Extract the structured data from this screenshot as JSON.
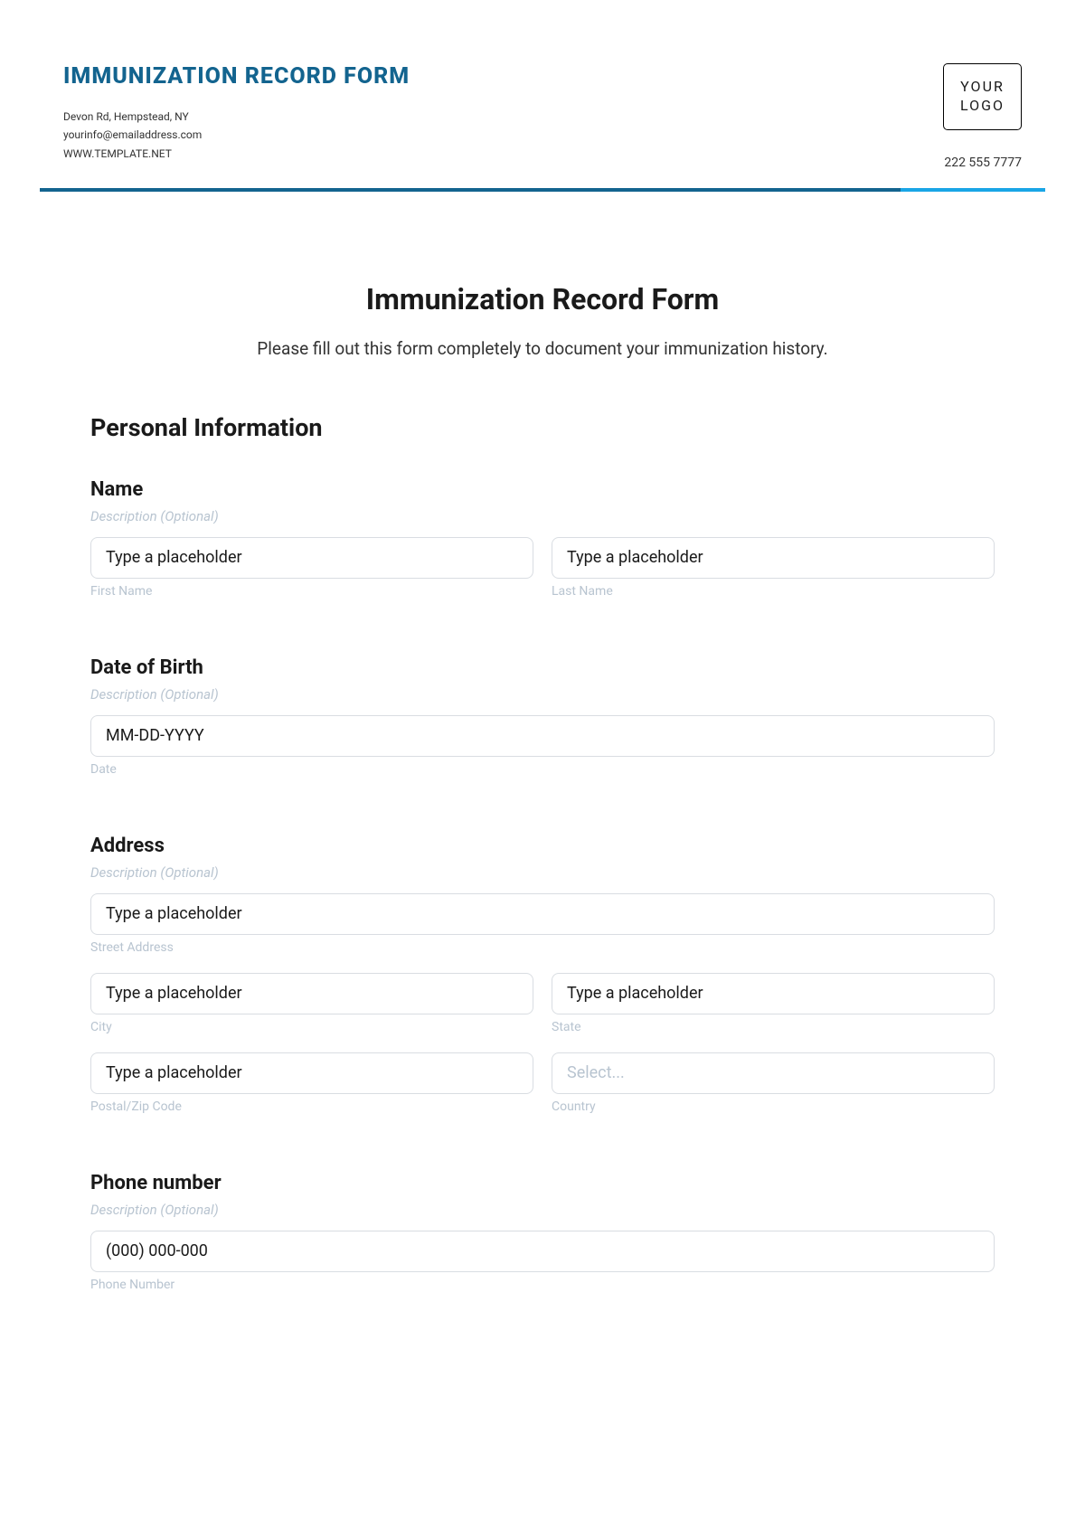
{
  "header": {
    "title": "IMMUNIZATION RECORD FORM",
    "address": "Devon Rd, Hempstead, NY",
    "email": "yourinfo@emailaddress.com",
    "website": "WWW.TEMPLATE.NET",
    "logo_line1": "YOUR",
    "logo_line2": "LOGO",
    "phone": "222 555 7777"
  },
  "form": {
    "title": "Immunization Record Form",
    "intro": "Please fill out this form completely to document your immunization history.",
    "section_personal": "Personal Information",
    "desc_optional": "Description (Optional)",
    "placeholder": "Type a placeholder",
    "name": {
      "label": "Name",
      "first_sub": "First Name",
      "last_sub": "Last Name"
    },
    "dob": {
      "label": "Date of Birth",
      "placeholder": "MM-DD-YYYY",
      "sub": "Date"
    },
    "address": {
      "label": "Address",
      "street_sub": "Street Address",
      "city_sub": "City",
      "state_sub": "State",
      "postal_sub": "Postal/Zip Code",
      "country_sub": "Country",
      "select_placeholder": "Select..."
    },
    "phone": {
      "label": "Phone number",
      "placeholder": "(000) 000-000",
      "sub": "Phone Number"
    }
  }
}
